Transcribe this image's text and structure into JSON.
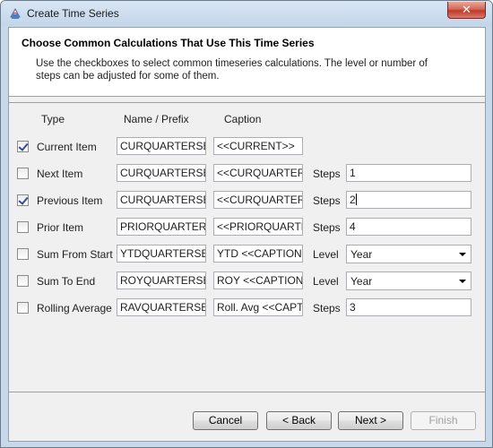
{
  "window": {
    "title": "Create Time Series"
  },
  "header": {
    "heading": "Choose Common Calculations That Use This Time Series",
    "description": "Use the checkboxes to select common timeseries calculations.  The level or number of steps can be adjusted for some of them."
  },
  "columns": {
    "type": "Type",
    "name": "Name / Prefix",
    "caption": "Caption"
  },
  "rows": [
    {
      "label": "Current Item",
      "checked": true,
      "name": "CURQUARTERSEL",
      "caption": "<<CURRENT>>",
      "param_label": "",
      "param_value": "",
      "param_kind": "none"
    },
    {
      "label": "Next Item",
      "checked": false,
      "name": "CURQUARTERSEL",
      "caption": "<<CURQUARTERS",
      "param_label": "Steps",
      "param_value": "1",
      "param_kind": "text"
    },
    {
      "label": "Previous Item",
      "checked": true,
      "name": "CURQUARTERSEL",
      "caption": "<<CURQUARTERS",
      "param_label": "Steps",
      "param_value": "2",
      "param_kind": "text"
    },
    {
      "label": "Prior Item",
      "checked": false,
      "name": "PRIORQUARTERS",
      "caption": "<<PRIORQUARTEF",
      "param_label": "Steps",
      "param_value": "4",
      "param_kind": "text"
    },
    {
      "label": "Sum From Start",
      "checked": false,
      "name": "YTDQUARTERSEL",
      "caption": "YTD <<CAPTION>>",
      "param_label": "Level",
      "param_value": "Year",
      "param_kind": "combo"
    },
    {
      "label": "Sum To End",
      "checked": false,
      "name": "ROYQUARTERSEL",
      "caption": "ROY <<CAPTION>>",
      "param_label": "Level",
      "param_value": "Year",
      "param_kind": "combo"
    },
    {
      "label": "Rolling Average",
      "checked": false,
      "name": "RAVQUARTERSEL",
      "caption": "Roll. Avg <<CAPTIO",
      "param_label": "Steps",
      "param_value": "3",
      "param_kind": "text"
    }
  ],
  "buttons": {
    "cancel": "Cancel",
    "back": "< Back",
    "next": "Next >",
    "finish": "Finish"
  },
  "colors": {
    "window_frame": "#c7d8ea",
    "dialog_bg": "#f0f0f0",
    "check_mark": "#3b4a8c",
    "close_button": "#c0392b"
  }
}
